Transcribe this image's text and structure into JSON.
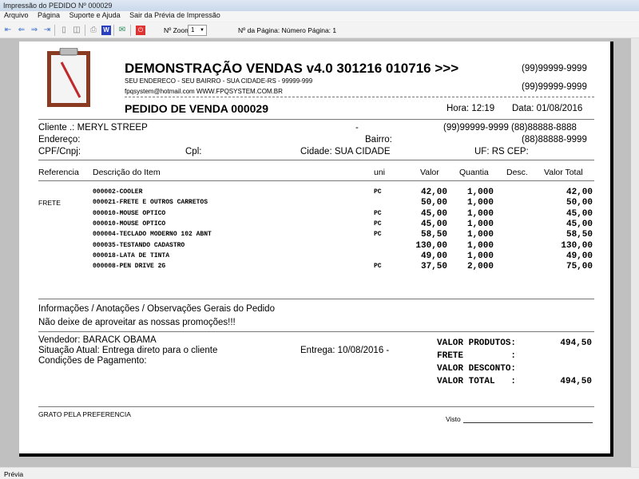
{
  "window": {
    "title": "Impressão do PEDIDO Nº 000029"
  },
  "menu": [
    "Arquivo",
    "Página",
    "Suporte e Ajuda",
    "Sair da Prévia de Impressão"
  ],
  "toolbar": {
    "zoom_label": "Nº Zoom",
    "zoom_value": "1",
    "page_info": "Nº da Página: Número Página: 1",
    "icons": [
      "first-page-icon",
      "prev-page-icon",
      "next-page-icon",
      "last-page-icon",
      "single-page-icon",
      "two-page-icon",
      "print-icon",
      "word-export-icon",
      "email-icon",
      "close-preview-icon"
    ]
  },
  "report": {
    "company": "DEMONSTRAÇÃO VENDAS v4.0 301216 010716 >>>",
    "address": "SEU ENDERECO - SEU BAIRRO - SUA CIDADE-RS - 99999-999",
    "contact": "fpqsystem@hotmail.com  WWW.FPQSYSTEM.COM.BR",
    "phone1": "(99)99999-9999",
    "phone2": "(99)99999-9999",
    "order_title": "PEDIDO DE VENDA 000029",
    "hora": "Hora: 12:19",
    "data": "Data: 01/08/2016",
    "client": {
      "cliente": "Cliente   .: MERYL STREEP",
      "dash": "-",
      "phones": "(99)99999-9999  (88)88888-8888",
      "endereco": "Endereço:",
      "bairro": "Bairro:",
      "phone3": "(88)88888-9999",
      "cpf": "CPF/Cnpj:",
      "cpl": "Cpl:",
      "cidade": "Cidade: SUA CIDADE",
      "uf": "UF: RS  CEP:"
    },
    "columns": [
      "Referencia",
      "Descrição do Item",
      "uni",
      "Valor",
      "Quantia",
      "Desc.",
      "Valor Total"
    ],
    "items": [
      {
        "ref": "",
        "desc": "000002-COOLER",
        "uni": "PC",
        "valor": "42,00",
        "qtd": "1,000",
        "desc_pct": "",
        "total": "42,00"
      },
      {
        "ref": "FRETE",
        "desc": "000021-FRETE E OUTROS CARRETOS",
        "uni": "",
        "valor": "50,00",
        "qtd": "1,000",
        "desc_pct": "",
        "total": "50,00"
      },
      {
        "ref": "",
        "desc": "000010-MOUSE OPTICO",
        "uni": "PC",
        "valor": "45,00",
        "qtd": "1,000",
        "desc_pct": "",
        "total": "45,00"
      },
      {
        "ref": "",
        "desc": "000010-MOUSE OPTICO",
        "uni": "PC",
        "valor": "45,00",
        "qtd": "1,000",
        "desc_pct": "",
        "total": "45,00"
      },
      {
        "ref": "",
        "desc": "000004-TECLADO MODERNO 102 ABNT",
        "uni": "PC",
        "valor": "58,50",
        "qtd": "1,000",
        "desc_pct": "",
        "total": "58,50"
      },
      {
        "ref": "",
        "desc": "000035-TESTANDO CADASTRO",
        "uni": "",
        "valor": "130,00",
        "qtd": "1,000",
        "desc_pct": "",
        "total": "130,00"
      },
      {
        "ref": "",
        "desc": "000018-LATA DE TINTA",
        "uni": "",
        "valor": "49,00",
        "qtd": "1,000",
        "desc_pct": "",
        "total": "49,00"
      },
      {
        "ref": "",
        "desc": "000008-PEN DRIVE 2G",
        "uni": "PC",
        "valor": "37,50",
        "qtd": "2,000",
        "desc_pct": "",
        "total": "75,00"
      }
    ],
    "notes_title": "Informações / Anotações / Observações Gerais do Pedido",
    "notes": "Não deixe de aproveitar as nossas promoções!!!",
    "vendedor": "Vendedor: BARACK OBAMA",
    "situacao": "Situação Atual: Entrega direto para o cliente",
    "entrega": "Entrega: 10/08/2016 -",
    "condicoes": "Condições de Pagamento:",
    "totals": [
      {
        "label": "VALOR PRODUTOS:",
        "value": "494,50"
      },
      {
        "label": "FRETE         :",
        "value": ""
      },
      {
        "label": "VALOR DESCONTO:",
        "value": ""
      },
      {
        "label": "VALOR TOTAL   :",
        "value": "494,50"
      }
    ],
    "footer": "GRATO PELA PREFERENCIA",
    "visto": "Visto"
  },
  "status": "Prévia"
}
